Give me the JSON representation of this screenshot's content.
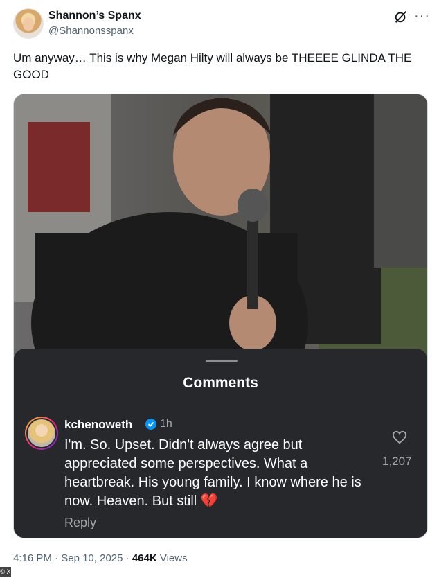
{
  "author": {
    "name": "Shannon’s Spanx",
    "handle": "@Shannonsspanx"
  },
  "tweet": {
    "text": "Um anyway… This is why Megan Hilty will always be THEEEE GLINDA THE GOOD"
  },
  "comments_panel": {
    "title": "Comments",
    "comment": {
      "username": "kchenoweth",
      "age": "1h",
      "text": "I'm.  So.  Upset.  Didn't always agree but appreciated some perspectives.  What a heartbreak.  His young family.  I know where he is now.  Heaven.  But still 💔",
      "likes": "1,207",
      "reply_label": "Reply"
    }
  },
  "meta": {
    "time": "4:16 PM",
    "date": "Sep 10, 2025",
    "views_count": "464K",
    "views_label": "Views"
  },
  "watermark": "© X",
  "colors": {
    "panel_bg": "#27282c",
    "verified_blue": "#0095f6",
    "secondary_text": "#536471"
  },
  "icons": [
    "grok-icon",
    "more-icon",
    "verified-icon",
    "heart-icon",
    "broken-heart-emoji"
  ]
}
